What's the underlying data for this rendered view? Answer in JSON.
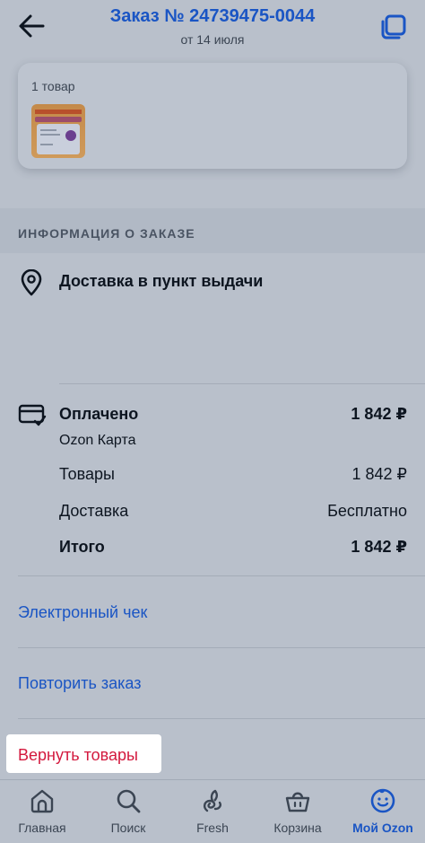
{
  "header": {
    "title": "Заказ № 24739475-0044",
    "subtitle": "от 14 июля",
    "back_icon": "arrow-left-icon",
    "copy_icon": "copy-icon"
  },
  "products": {
    "count_label": "1 товар"
  },
  "order_info": {
    "section_title": "ИНФОРМАЦИЯ О ЗАКАЗЕ",
    "delivery_label": "Доставка в пункт выдачи"
  },
  "payment": {
    "status_label": "Оплачено",
    "status_value": "1 842 ₽",
    "method": "Ozon Карта",
    "rows": [
      {
        "label": "Товары",
        "value": "1 842 ₽"
      },
      {
        "label": "Доставка",
        "value": "Бесплатно"
      },
      {
        "label": "Итого",
        "value": "1 842 ₽"
      }
    ]
  },
  "actions": {
    "receipt_link": "Электронный чек",
    "repeat_link": "Повторить заказ",
    "return_link": "Вернуть товары"
  },
  "tabbar": {
    "items": [
      {
        "label": "Главная",
        "icon": "home-icon"
      },
      {
        "label": "Поиск",
        "icon": "search-icon"
      },
      {
        "label": "Fresh",
        "icon": "fresh-icon"
      },
      {
        "label": "Корзина",
        "icon": "cart-icon"
      },
      {
        "label": "Мой Ozon",
        "icon": "profile-smile-icon",
        "active": true
      }
    ]
  },
  "colors": {
    "accent": "#1a55c4",
    "danger": "#d3183d",
    "overlay_bg": "#b9c0cb"
  }
}
